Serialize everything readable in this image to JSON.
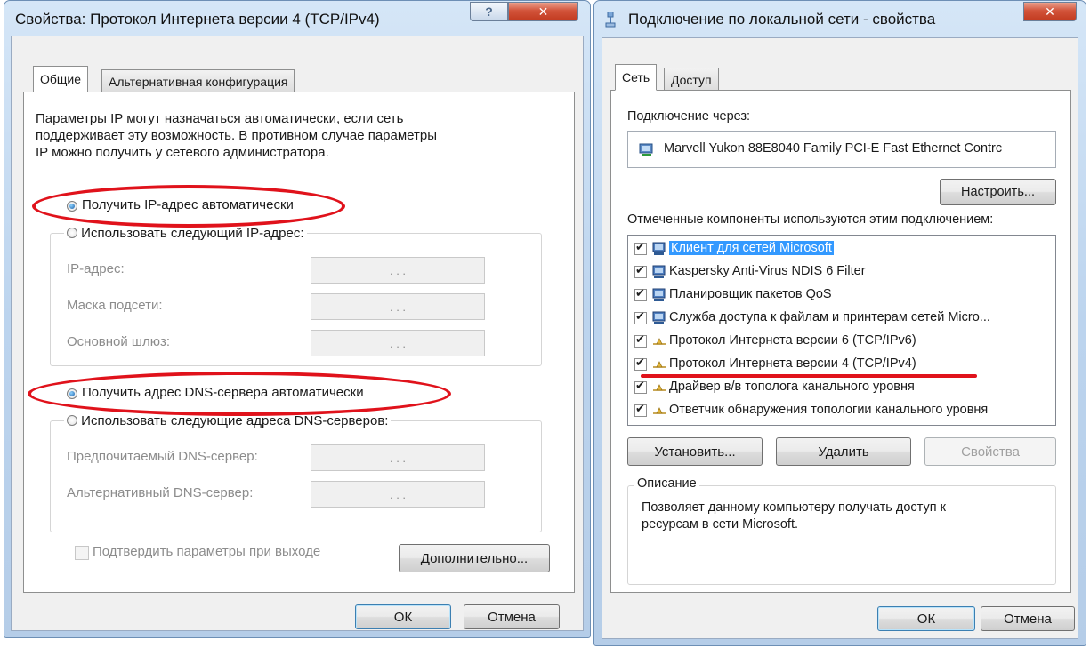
{
  "left_dialog": {
    "title": "Свойства: Протокол Интернета версии 4 (TCP/IPv4)",
    "help_button": "?",
    "close_button": "✕",
    "tabs": [
      "Общие",
      "Альтернативная конфигурация"
    ],
    "description": [
      "Параметры IP могут назначаться автоматически, если сеть",
      "поддерживает эту возможность. В противном случае параметры",
      "IP можно получить у сетевого администратора."
    ],
    "radio_ip_auto": "Получить IP-адрес автоматически",
    "radio_ip_manual": "Использовать следующий IP-адрес:",
    "ip_fields": [
      {
        "label": "IP-адрес:",
        "value": ".    .    ."
      },
      {
        "label": "Маска подсети:",
        "value": ".    .    ."
      },
      {
        "label": "Основной шлюз:",
        "value": ".    .    ."
      }
    ],
    "radio_dns_auto": "Получить адрес DNS-сервера автоматически",
    "radio_dns_manual": "Использовать следующие адреса DNS-серверов:",
    "dns_fields": [
      {
        "label": "Предпочитаемый DNS-сервер:",
        "value": ".    .    ."
      },
      {
        "label": "Альтернативный DNS-сервер:",
        "value": ".    .    ."
      }
    ],
    "validate_checkbox": "Подтвердить параметры при выходе",
    "advanced_button": "Дополнительно...",
    "ok_button": "ОК",
    "cancel_button": "Отмена"
  },
  "right_dialog": {
    "title": "Подключение по локальной сети - свойства",
    "close_button": "✕",
    "tabs": [
      "Сеть",
      "Доступ"
    ],
    "connect_using_label": "Подключение через:",
    "adapter_name": "Marvell Yukon 88E8040 Family PCI-E Fast Ethernet Contrc",
    "configure_button": "Настроить...",
    "components_label": "Отмеченные компоненты используются этим подключением:",
    "components": [
      {
        "label": "Клиент для сетей Microsoft",
        "checked": true,
        "selected": true
      },
      {
        "label": "Kaspersky Anti-Virus NDIS 6 Filter",
        "checked": true,
        "selected": false
      },
      {
        "label": "Планировщик пакетов QoS",
        "checked": true,
        "selected": false
      },
      {
        "label": "Служба доступа к файлам и принтерам сетей Micro...",
        "checked": true,
        "selected": false
      },
      {
        "label": "Протокол Интернета версии 6 (TCP/IPv6)",
        "checked": true,
        "selected": false
      },
      {
        "label": "Протокол Интернета версии 4 (TCP/IPv4)",
        "checked": true,
        "selected": false
      },
      {
        "label": "Драйвер в/в тополога канального уровня",
        "checked": true,
        "selected": false
      },
      {
        "label": "Ответчик обнаружения топологии канального уровня",
        "checked": true,
        "selected": false
      }
    ],
    "install_button": "Установить...",
    "uninstall_button": "Удалить",
    "properties_button": "Свойства",
    "description_group": "Описание",
    "description_text": [
      "Позволяет данному компьютеру получать доступ к",
      "ресурсам в сети Microsoft."
    ],
    "ok_button": "ОК",
    "cancel_button": "Отмена"
  },
  "colors": {
    "annotation_red": "#e0121b",
    "selection_blue": "#3399ff",
    "title_bar": "#bcd4ee"
  }
}
